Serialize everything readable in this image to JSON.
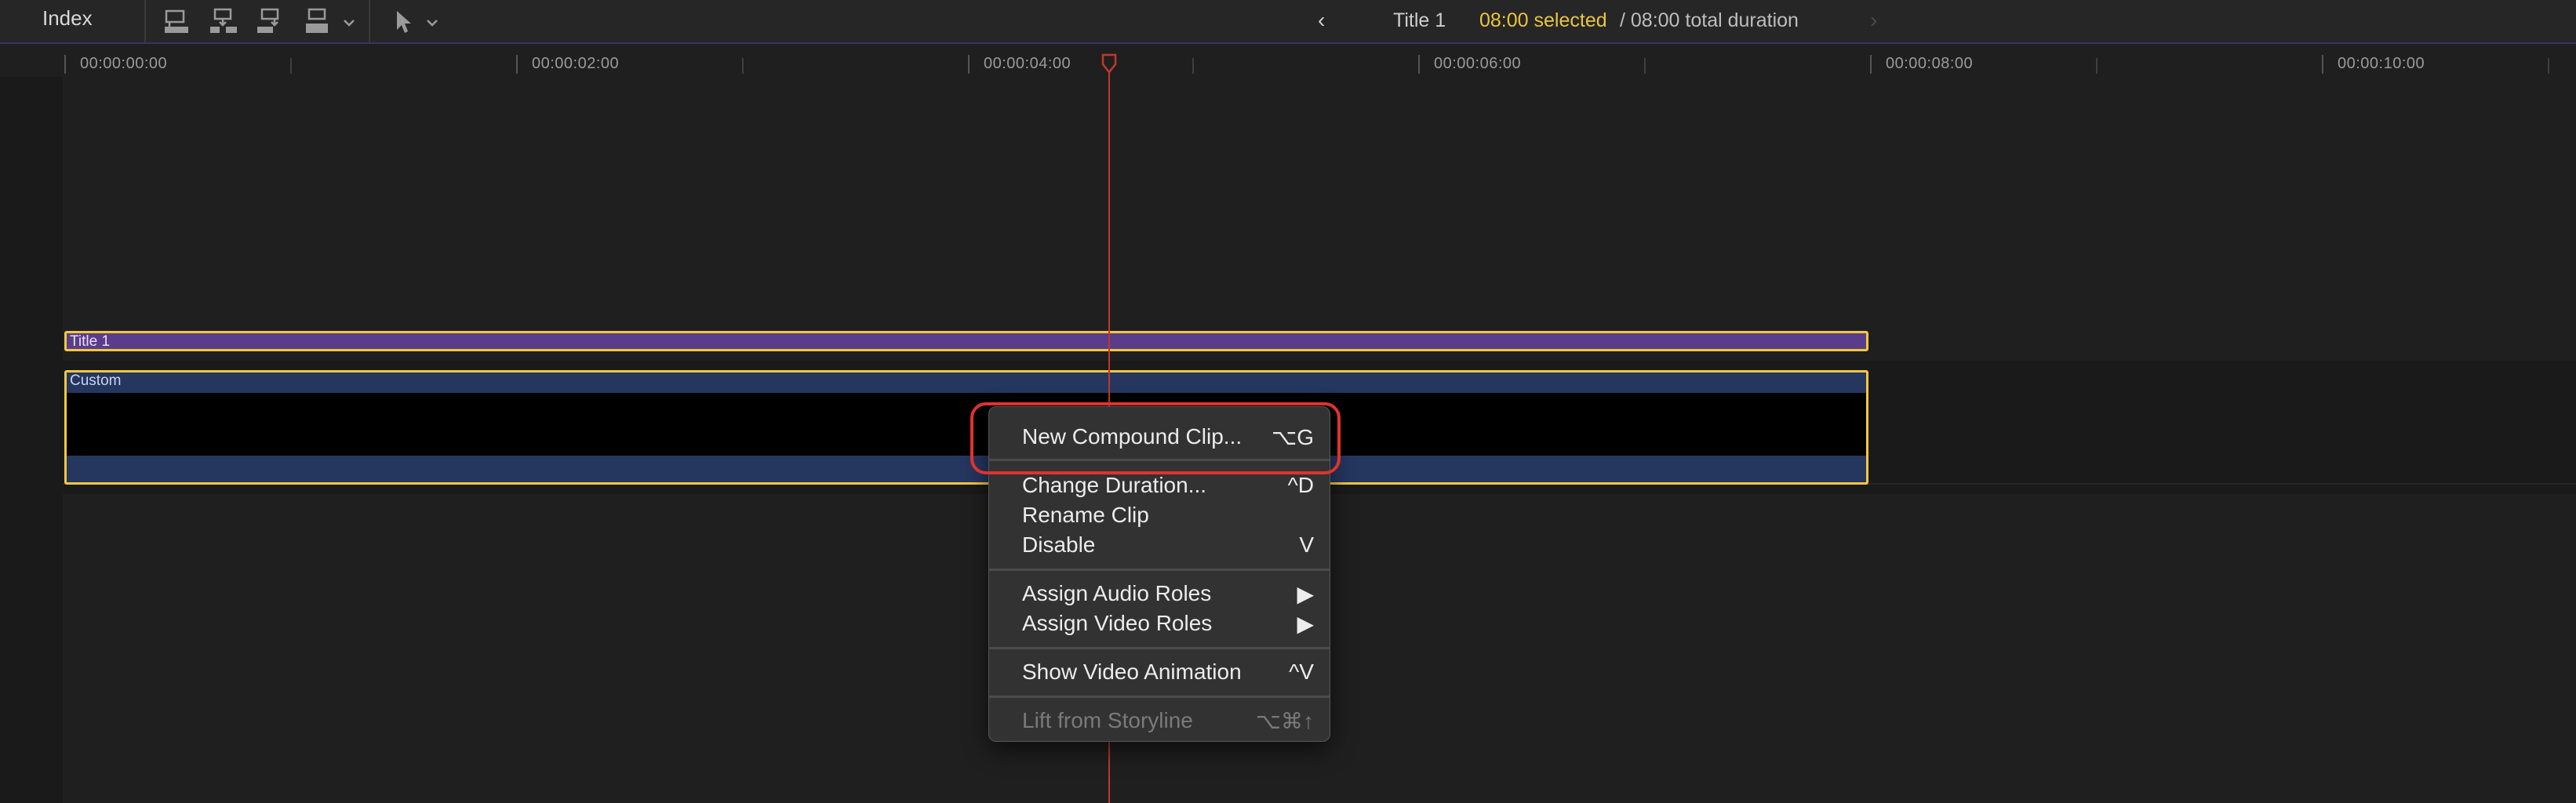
{
  "toolbar": {
    "index_label": "Index",
    "clip_title": "Title 1",
    "selected_duration": "08:00 selected",
    "total_duration": "/ 08:00 total duration",
    "prev_arrow": "‹",
    "next_arrow": "›",
    "icons": [
      "connect-clip-icon",
      "insert-clip-icon",
      "append-clip-icon",
      "overwrite-clip-icon",
      "select-tool-icon"
    ]
  },
  "ruler": {
    "labels": [
      "00:00:00:00",
      "00:00:02:00",
      "00:00:04:00",
      "00:00:06:00",
      "00:00:08:00",
      "00:00:10:00"
    ]
  },
  "timeline": {
    "title_clip_label": "Title 1",
    "custom_clip_label": "Custom"
  },
  "context_menu": {
    "groups": [
      [
        {
          "label": "New Compound Clip...",
          "shortcut": "⌥G",
          "enabled": true
        }
      ],
      [
        {
          "label": "Change Duration...",
          "shortcut": "^D",
          "enabled": true
        },
        {
          "label": "Rename Clip",
          "shortcut": "",
          "enabled": true
        },
        {
          "label": "Disable",
          "shortcut": "V",
          "enabled": true
        }
      ],
      [
        {
          "label": "Assign Audio Roles",
          "shortcut": "▶",
          "enabled": true
        },
        {
          "label": "Assign Video Roles",
          "shortcut": "▶",
          "enabled": true
        }
      ],
      [
        {
          "label": "Show Video Animation",
          "shortcut": "^V",
          "enabled": true
        }
      ],
      [
        {
          "label": "Lift from Storyline",
          "shortcut": "⌥⌘↑",
          "enabled": false
        }
      ]
    ]
  },
  "colors": {
    "accent_selection": "#f5c83e",
    "playhead": "#c0392b",
    "title_clip": "#5a3d8a",
    "custom_clip": "#25365f",
    "highlight": "#e0322e"
  }
}
